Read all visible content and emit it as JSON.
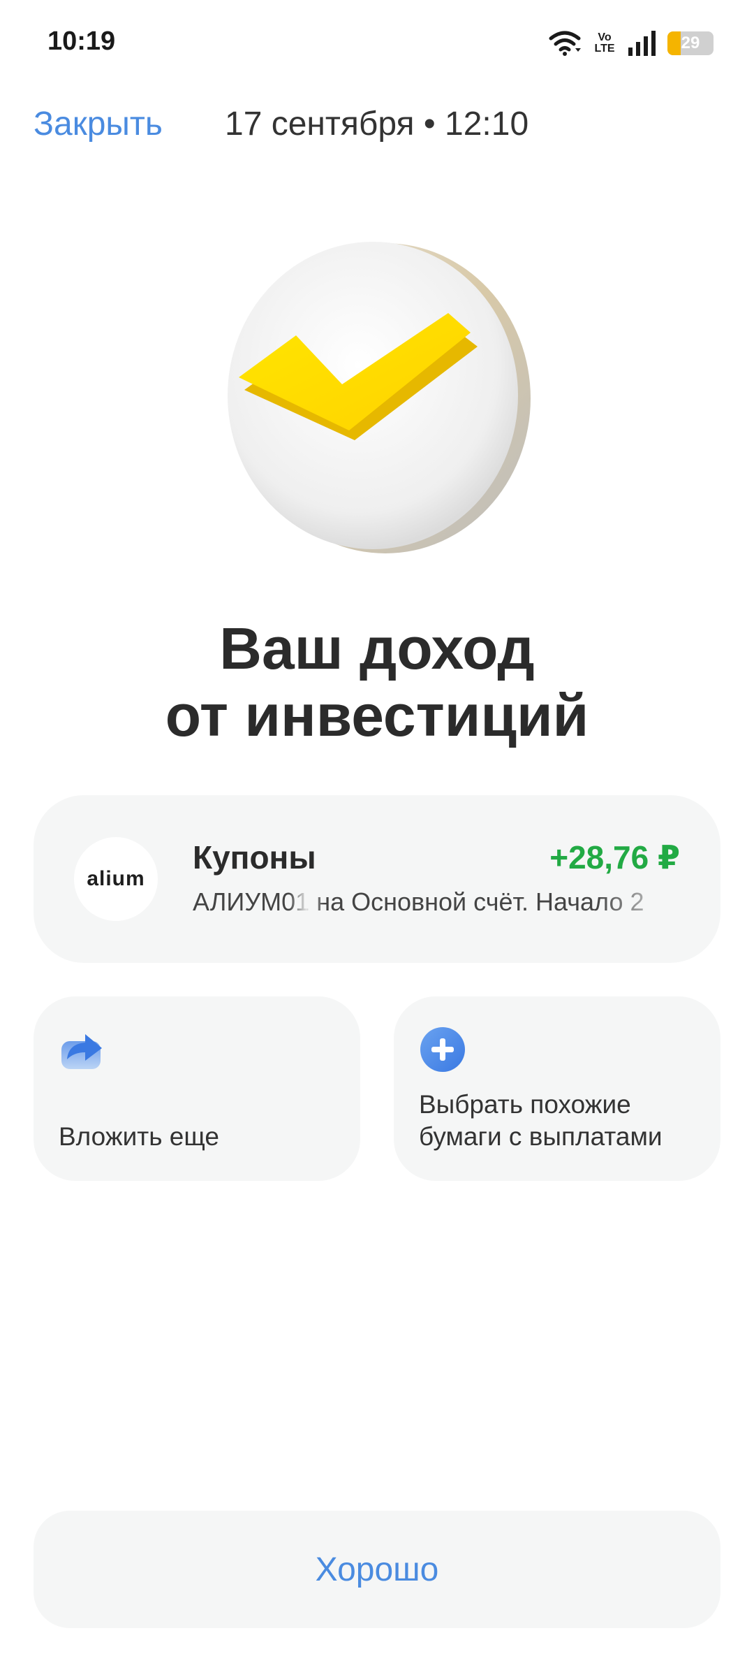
{
  "status_bar": {
    "time": "10:19",
    "network_label_top": "Vo",
    "network_label_bottom": "LTE",
    "battery_level": "29",
    "battery_fraction": 0.29,
    "battery_color": "#f5b400"
  },
  "header": {
    "close_label": "Закрыть",
    "date_text": "17 сентября • 12:10"
  },
  "hero": {
    "icon_name": "checkmark-coin-icon"
  },
  "title": {
    "line1": "Ваш доход",
    "line2": "от инвестиций"
  },
  "coupon": {
    "logo_text": "alium",
    "title": "Купоны",
    "amount": "+28,76 ₽",
    "amount_color": "#22aa44",
    "description": "АЛИУМ01 на Основной счёт. Начало 2"
  },
  "actions": {
    "invest_more_label": "Вложить еще",
    "invest_more_icon": "share-forward-icon",
    "similar_label_line1": "Выбрать похожие",
    "similar_label_line2": "бумаги с выплатами",
    "similar_icon": "plus-circle-icon"
  },
  "footer": {
    "ok_label": "Хорошо"
  },
  "colors": {
    "accent": "#4a8be0",
    "card_bg": "#f5f6f6",
    "check_yellow": "#ffdd00"
  }
}
